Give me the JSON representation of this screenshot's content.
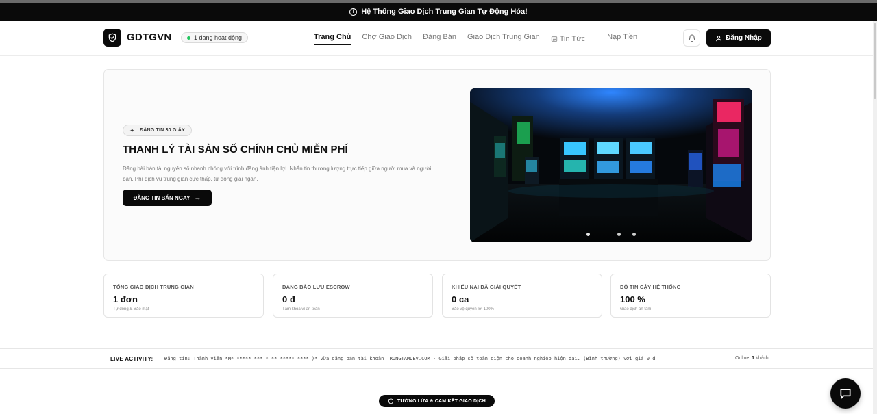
{
  "announcement": {
    "text": "Hệ Thống Giao Dịch Trung Gian Tự Động Hóa!",
    "icon": "info-icon"
  },
  "header": {
    "brand": "GDTGVN",
    "logo_icon": "shield-icon",
    "online_badge": "1 đang hoạt động",
    "nav": [
      {
        "label": "Trang Chủ",
        "active": true
      },
      {
        "label": "Chợ Giao Dịch",
        "active": false
      },
      {
        "label": "Đăng Bán",
        "active": false
      },
      {
        "label": "Giao Dịch Trung Gian",
        "active": false
      },
      {
        "label": "Tin Tức",
        "active": false,
        "icon": "newspaper-icon"
      },
      {
        "label": "Nạp Tiền",
        "active": false
      }
    ],
    "bell_icon": "bell-icon",
    "login_label": "Đăng Nhập",
    "login_icon": "user-icon"
  },
  "hero": {
    "badge": "ĐĂNG TIN 30 GIÂY",
    "badge_icon": "sparkles-icon",
    "title": "THANH LÝ TÀI SẢN SỐ CHÍNH CHỦ MIỄN PHÍ",
    "description": "Đăng bài bán tài nguyên số nhanh chóng với trình đăng ảnh tiện lợi. Nhắn tin thương lượng trực tiếp giữa người mua và người bán. Phí dịch vụ trung gian cực thấp, tự động giải ngân.",
    "cta_label": "ĐĂNG TIN BÁN NGAY",
    "cta_icon": "arrow-right-icon",
    "image_alt": "arcade-machines-image",
    "carousel_count": 3,
    "carousel_active": 0
  },
  "stats": [
    {
      "label": "TỔNG GIAO DỊCH TRUNG GIAN",
      "value": "1 đơn",
      "sub": "Tự động & Bảo mật"
    },
    {
      "label": "ĐANG BẢO LƯU ESCROW",
      "value": "0 đ",
      "sub": "Tạm khóa vì an toàn"
    },
    {
      "label": "KHIẾU NẠI ĐÃ GIẢI QUYẾT",
      "value": "0 ca",
      "sub": "Bảo vệ quyền lợi 100%"
    },
    {
      "label": "ĐỘ TIN CẬY HỆ THỐNG",
      "value": "100 %",
      "sub": "Giao dịch an tâm"
    }
  ],
  "ticker": {
    "label": "LIVE ACTIVITY:",
    "message": "Đăng tin: Thành viên *M* ***** *** * ** ***** **** )* vừa đăng bán tài khoản TRUNGTAMDEV.COM - Giải pháp số toàn diện cho doanh nghiệp hiện đại. (Bình thường) với giá 0 đ",
    "online_prefix": "Online:",
    "online_count": "1",
    "online_suffix": "khách"
  },
  "firewall": {
    "label": "TƯỜNG LỬA & CAM KẾT GIAO DỊCH",
    "icon": "shield-icon"
  },
  "chat": {
    "icon": "chat-icon"
  },
  "colors": {
    "primary": "#0a0a0a",
    "online_dot": "#22c55e",
    "border": "#e6e6e6",
    "muted_text": "#777777"
  }
}
